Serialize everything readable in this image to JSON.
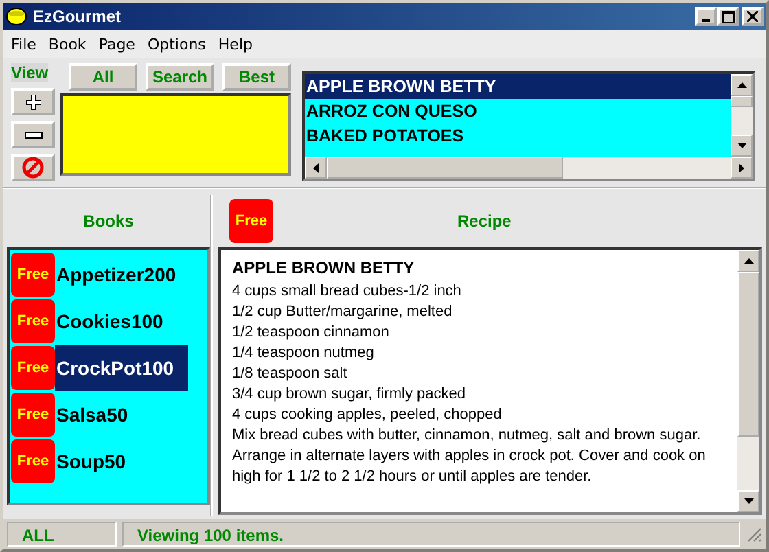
{
  "window": {
    "title": "EzGourmet"
  },
  "menu": [
    "File",
    "Book",
    "Page",
    "Options",
    "Help"
  ],
  "view": {
    "label": "View"
  },
  "filter_buttons": [
    "All",
    "Search",
    "Best"
  ],
  "recipe_list": [
    {
      "name": "APPLE BROWN BETTY",
      "selected": true
    },
    {
      "name": "ARROZ CON QUESO",
      "selected": false
    },
    {
      "name": "BAKED POTATOES",
      "selected": false
    }
  ],
  "books": {
    "header": "Books",
    "items": [
      {
        "badge": "Free",
        "name": "Appetizer200",
        "selected": false
      },
      {
        "badge": "Free",
        "name": "Cookies100",
        "selected": false
      },
      {
        "badge": "Free",
        "name": "CrockPot100",
        "selected": true
      },
      {
        "badge": "Free",
        "name": "Salsa50",
        "selected": false
      },
      {
        "badge": "Free",
        "name": "Soup50",
        "selected": false
      }
    ]
  },
  "recipe": {
    "badge": "Free",
    "header": "Recipe",
    "title": "APPLE BROWN BETTY",
    "ingredients": [
      "4 cups small bread cubes-1/2 inch",
      "1/2 cup Butter/margarine, melted",
      "1/2 teaspoon cinnamon",
      "1/4 teaspoon nutmeg",
      "1/8 teaspoon salt",
      "3/4 cup brown sugar, firmly packed",
      "4 cups cooking apples, peeled, chopped"
    ],
    "directions": "Mix bread cubes with butter, cinnamon, nutmeg, salt and brown sugar. Arrange in alternate layers with apples in crock pot. Cover and cook on high for 1 1/2 to 2 1/2 hours or until apples are tender."
  },
  "status_bar": [
    "ALL",
    "Viewing 100 items."
  ]
}
